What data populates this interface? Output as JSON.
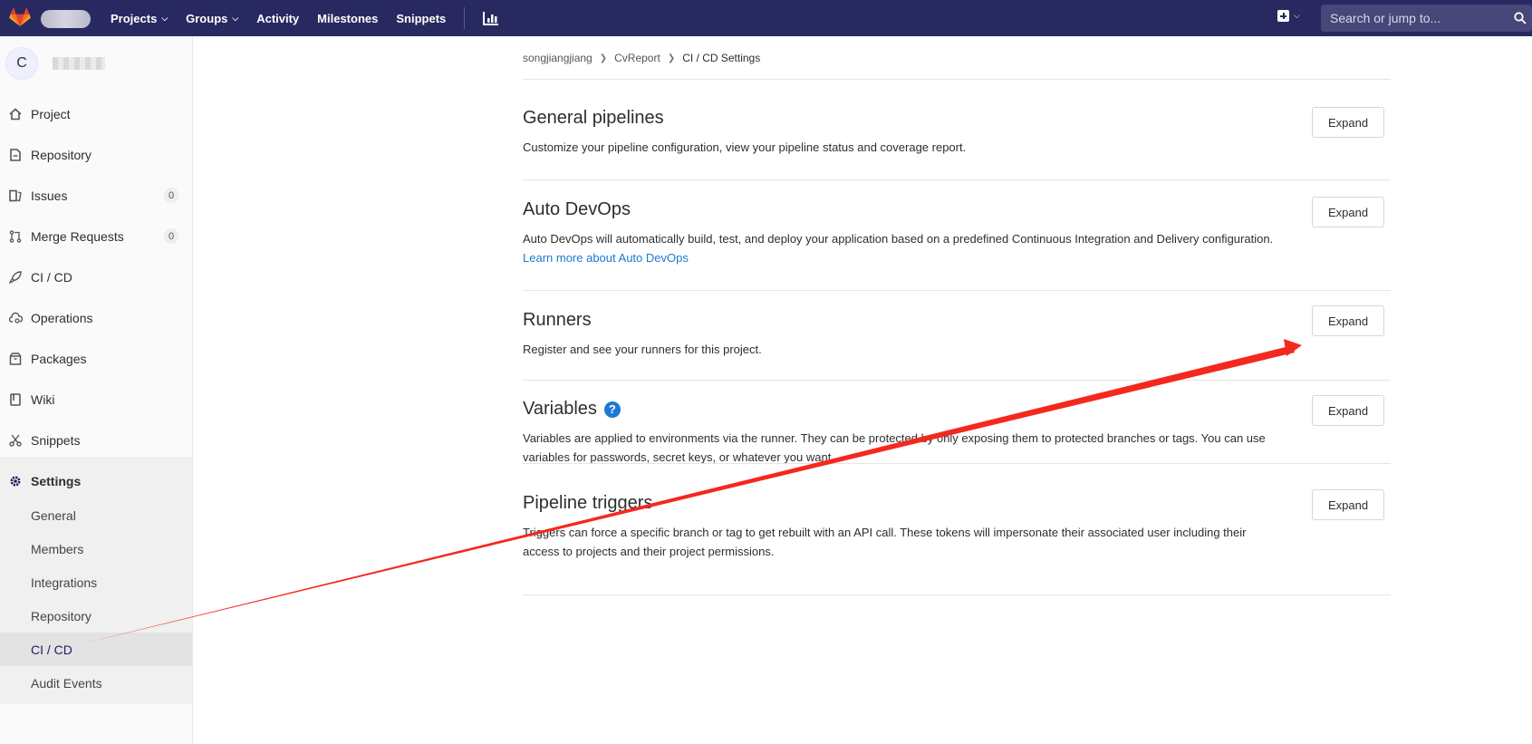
{
  "colors": {
    "topbar": "#292961",
    "link": "#1f78d1",
    "annotation_arrow": "#f5281e"
  },
  "topnav": {
    "items": [
      {
        "label": "Projects",
        "has_caret": true
      },
      {
        "label": "Groups",
        "has_caret": true
      },
      {
        "label": "Activity",
        "has_caret": false
      },
      {
        "label": "Milestones",
        "has_caret": false
      },
      {
        "label": "Snippets",
        "has_caret": false
      }
    ],
    "chart_icon": "chart-icon",
    "plus_icon": "plus-square-icon",
    "search_placeholder": "Search or jump to..."
  },
  "sidebar": {
    "avatar_letter": "C",
    "items": [
      {
        "label": "Project",
        "icon": "home-icon"
      },
      {
        "label": "Repository",
        "icon": "doc-icon"
      },
      {
        "label": "Issues",
        "icon": "issues-icon",
        "count": "0"
      },
      {
        "label": "Merge Requests",
        "icon": "merge-icon",
        "count": "0"
      },
      {
        "label": "CI / CD",
        "icon": "rocket-icon"
      },
      {
        "label": "Operations",
        "icon": "cloud-gear-icon"
      },
      {
        "label": "Packages",
        "icon": "package-icon"
      },
      {
        "label": "Wiki",
        "icon": "book-icon"
      },
      {
        "label": "Snippets",
        "icon": "scissors-icon"
      },
      {
        "label": "Settings",
        "icon": "gear-icon"
      }
    ],
    "settings_sub": [
      "General",
      "Members",
      "Integrations",
      "Repository",
      "CI / CD",
      "Audit Events"
    ]
  },
  "breadcrumb": [
    "songjiangjiang",
    "CvReport",
    "CI / CD Settings"
  ],
  "sections": [
    {
      "title": "General pipelines",
      "desc": "Customize your pipeline configuration, view your pipeline status and coverage report.",
      "button": "Expand"
    },
    {
      "title": "Auto DevOps",
      "desc": "Auto DevOps will automatically build, test, and deploy your application based on a predefined Continuous Integration and Delivery configuration.",
      "link": "Learn more about Auto DevOps",
      "button": "Expand"
    },
    {
      "title": "Runners",
      "desc": "Register and see your runners for this project.",
      "button": "Expand"
    },
    {
      "title": "Variables",
      "desc": "Variables are applied to environments via the runner. They can be protected by only exposing them to protected branches or tags. You can use variables for passwords, secret keys, or whatever you want.",
      "button": "Expand"
    },
    {
      "title": "Pipeline triggers",
      "desc": "Triggers can force a specific branch or tag to get rebuilt with an API call. These tokens will impersonate their associated user including their access to projects and their project permissions.",
      "button": "Expand"
    }
  ]
}
